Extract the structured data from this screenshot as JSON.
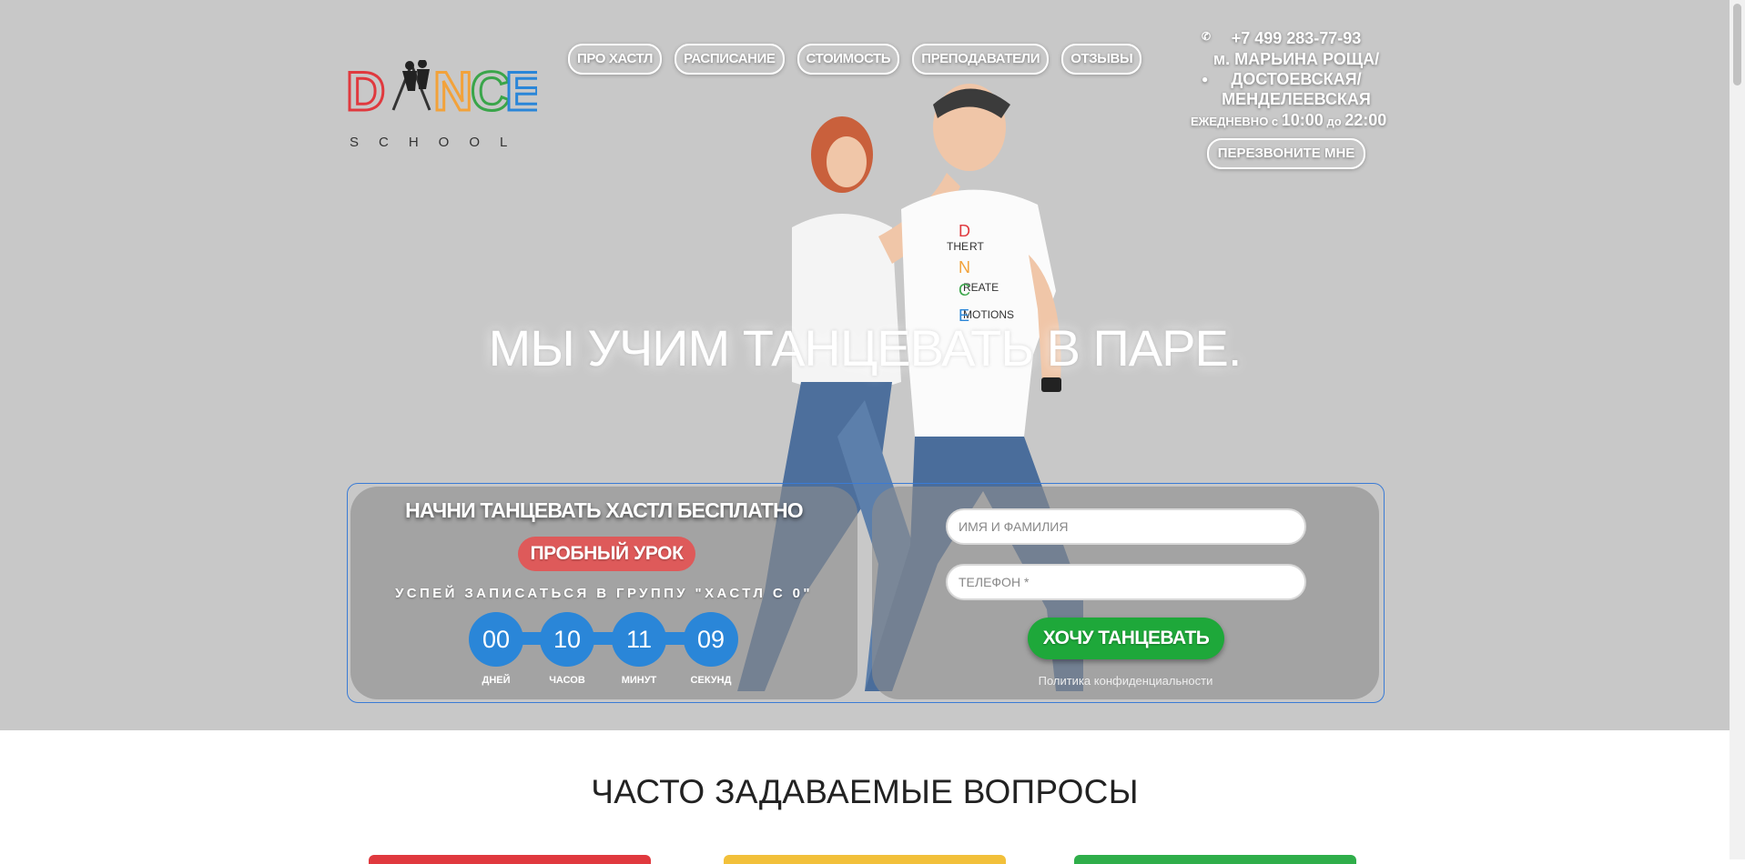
{
  "logo": {
    "letters": [
      "D",
      "N",
      "C",
      "E"
    ],
    "school": "SCHOOL",
    "colors": [
      "#e0393e",
      "#f2a23a",
      "#3aa54a",
      "#2a86d8"
    ]
  },
  "nav": {
    "items": [
      {
        "label": "ПРО ХАСТЛ"
      },
      {
        "label": "РАСПИСАНИЕ"
      },
      {
        "label": "СТОИМОСТЬ"
      },
      {
        "label": "ПРЕПОДАВАТЕЛИ"
      },
      {
        "label": "ОТЗЫВЫ"
      }
    ]
  },
  "contacts": {
    "phone": "+7 499 283-77-93",
    "metro": "м. МАРЬИНА РОЩА/ ДОСТОЕВСКАЯ/ МЕНДЕЛЕЕВСКАЯ",
    "hours_prefix": "ЕЖЕДНЕВНО с",
    "hours_from": "10:00",
    "hours_mid": "до",
    "hours_to": "22:00",
    "callback_label": "ПЕРЕЗВОНИТЕ МНЕ",
    "phone_icon": "phone-icon",
    "location_icon": "map-pin-icon"
  },
  "hero": {
    "headline": "МЫ УЧИМ ТАНЦЕВАТЬ В ПАРЕ.",
    "shirt_text": [
      "THE",
      "RT",
      "REATE",
      "MOTIONS"
    ]
  },
  "offer": {
    "title": "НАЧНИ ТАНЦЕВАТЬ ХАСТЛ БЕСПЛАТНО",
    "trial_label": "ПРОБНЫЙ УРОК",
    "hurry": "УСПЕЙ ЗАПИСАТЬСЯ В ГРУППУ \"ХАСТЛ С 0\""
  },
  "timer": {
    "units": [
      {
        "value": "00",
        "label": "ДНЕЙ"
      },
      {
        "value": "10",
        "label": "ЧАСОВ"
      },
      {
        "value": "11",
        "label": "МИНУТ"
      },
      {
        "value": "09",
        "label": "СЕКУНД"
      }
    ],
    "color": "#2a86d8"
  },
  "form": {
    "name_placeholder": "ИМЯ И ФАМИЛИЯ",
    "phone_placeholder": "ТЕЛЕФОН *",
    "submit_label": "ХОЧУ ТАНЦЕВАТЬ",
    "policy_label": "Политика конфиденциальности",
    "submit_color": "#1ea83a"
  },
  "faq": {
    "title": "ЧАСТО ЗАДАВАЕМЫЕ ВОПРОСЫ",
    "card_colors": [
      "#e0393e",
      "#f2c03a",
      "#2fae4a"
    ]
  }
}
